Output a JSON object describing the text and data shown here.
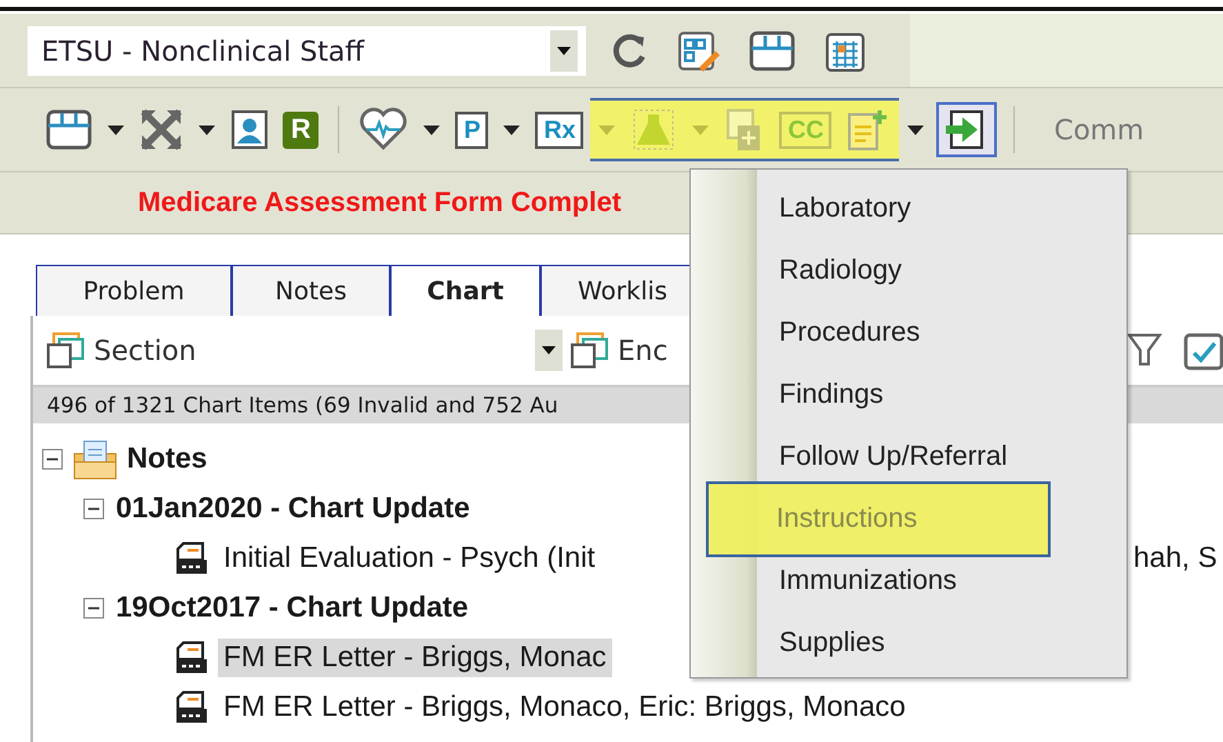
{
  "profile_select": {
    "value": "ETSU - Nonclinical Staff"
  },
  "toolbar_top": [
    {
      "kind": "refresh"
    },
    {
      "kind": "grid-edit"
    },
    {
      "kind": "layout"
    },
    {
      "kind": "calendar"
    }
  ],
  "toolbar": [
    {
      "kind": "layout",
      "highlighted": false
    },
    {
      "kind": "caret",
      "highlighted": false
    },
    {
      "kind": "expand",
      "highlighted": false
    },
    {
      "kind": "caret",
      "highlighted": false
    },
    {
      "kind": "contact",
      "highlighted": false
    },
    {
      "kind": "letter",
      "text": "R",
      "highlighted": false
    },
    {
      "kind": "separator",
      "highlighted": false
    },
    {
      "kind": "heart",
      "highlighted": false
    },
    {
      "kind": "caret",
      "highlighted": false
    },
    {
      "kind": "letter-box",
      "text": "P",
      "highlighted": false
    },
    {
      "kind": "caret",
      "highlighted": false
    },
    {
      "kind": "letter-box",
      "text": "Rx",
      "highlighted": false
    },
    {
      "kind": "caret",
      "highlighted": true
    },
    {
      "kind": "flask",
      "highlighted": true
    },
    {
      "kind": "caret",
      "highlighted": true
    },
    {
      "kind": "doc-plus",
      "highlighted": true
    },
    {
      "kind": "letter-box",
      "text": "CC",
      "highlighted": true
    },
    {
      "kind": "note-plus",
      "highlighted": true
    },
    {
      "kind": "caret",
      "highlighted": false
    },
    {
      "kind": "enter",
      "highlighted": false,
      "pressed": true
    },
    {
      "kind": "separator",
      "highlighted": false
    },
    {
      "kind": "label",
      "text": "Comm",
      "highlighted": false
    }
  ],
  "banner": "Medicare Assessment Form Complet",
  "tabs": [
    {
      "label": "Problem",
      "selected": false
    },
    {
      "label": "Notes",
      "selected": false
    },
    {
      "label": "Chart",
      "selected": true
    },
    {
      "label": "Worklis",
      "selected": false
    }
  ],
  "section_select": {
    "value": "Section"
  },
  "encounter_select": {
    "value": "Enc"
  },
  "count": "496 of 1321 Chart Items (69 Invalid and 752 Au",
  "tree": [
    {
      "label": "Notes",
      "expanded": true,
      "children": [
        {
          "label": "01Jan2020 - Chart Update",
          "expanded": true,
          "children": [
            {
              "label": "Initial Evaluation - Psych (Init",
              "trailing": "hah, S",
              "selected": false
            }
          ]
        },
        {
          "label": "19Oct2017 - Chart Update",
          "expanded": true,
          "children": [
            {
              "label": "FM ER Letter - Briggs, Monac",
              "selected": true
            },
            {
              "label": "FM ER Letter - Briggs, Monaco, Eric: Briggs, Monaco",
              "selected": false
            }
          ]
        }
      ]
    }
  ],
  "menu": [
    {
      "label": "Laboratory",
      "highlighted": false
    },
    {
      "label": "Radiology",
      "highlighted": false
    },
    {
      "label": "Procedures",
      "highlighted": false
    },
    {
      "label": "Findings",
      "highlighted": false
    },
    {
      "label": "Follow Up/Referral",
      "highlighted": false
    },
    {
      "label": "Instructions",
      "highlighted": true
    },
    {
      "label": "Immunizations",
      "highlighted": false
    },
    {
      "label": "Supplies",
      "highlighted": false
    }
  ]
}
